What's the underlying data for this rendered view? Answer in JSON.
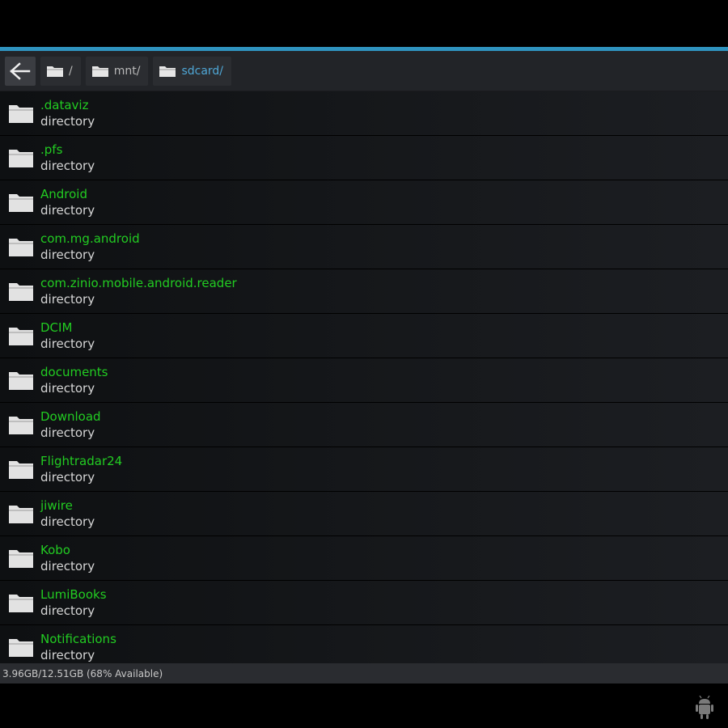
{
  "colors": {
    "accent": "#2f93bf",
    "name_text": "#22cc22",
    "type_text": "#d6d6d6",
    "active_crumb": "#4fa7d6"
  },
  "navigation": {
    "back_icon": "arrow-left-icon",
    "breadcrumbs": [
      {
        "label": "/",
        "icon": "folder-icon"
      },
      {
        "label": "mnt/",
        "icon": "folder-icon"
      },
      {
        "label": "sdcard/",
        "icon": "folder-icon",
        "active": true
      }
    ]
  },
  "files": [
    {
      "name": ".dataviz",
      "type": "directory"
    },
    {
      "name": ".pfs",
      "type": "directory"
    },
    {
      "name": "Android",
      "type": "directory"
    },
    {
      "name": "com.mg.android",
      "type": "directory"
    },
    {
      "name": "com.zinio.mobile.android.reader",
      "type": "directory"
    },
    {
      "name": "DCIM",
      "type": "directory"
    },
    {
      "name": "documents",
      "type": "directory"
    },
    {
      "name": "Download",
      "type": "directory"
    },
    {
      "name": "Flightradar24",
      "type": "directory"
    },
    {
      "name": "jiwire",
      "type": "directory"
    },
    {
      "name": "Kobo",
      "type": "directory"
    },
    {
      "name": "LumiBooks",
      "type": "directory"
    },
    {
      "name": "Notifications",
      "type": "directory"
    }
  ],
  "status": {
    "storage": "3.96GB/12.51GB (68% Available)"
  },
  "system_bar": {
    "icon": "android-debug-icon"
  }
}
